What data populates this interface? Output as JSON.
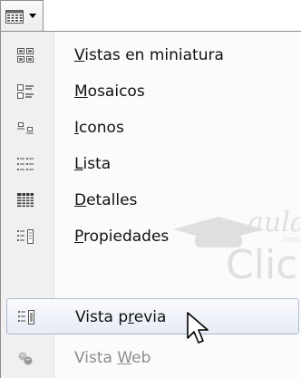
{
  "toolbar": {
    "button_icon": "view-details-icon",
    "dropdown_icon": "chevron-down-icon"
  },
  "menu": {
    "items": [
      {
        "pre": "",
        "key": "V",
        "post": "istas en miniatura",
        "icon": "thumbnails-view-icon",
        "enabled": true,
        "selected": false
      },
      {
        "pre": "",
        "key": "M",
        "post": "osaicos",
        "icon": "tiles-view-icon",
        "enabled": true,
        "selected": false
      },
      {
        "pre": "",
        "key": "I",
        "post": "conos",
        "icon": "icons-view-icon",
        "enabled": true,
        "selected": false
      },
      {
        "pre": "",
        "key": "L",
        "post": "ista",
        "icon": "list-view-icon",
        "enabled": true,
        "selected": false
      },
      {
        "pre": "",
        "key": "D",
        "post": "etalles",
        "icon": "details-view-icon",
        "enabled": true,
        "selected": false
      },
      {
        "pre": "",
        "key": "P",
        "post": "ropiedades",
        "icon": "properties-view-icon",
        "enabled": true,
        "selected": false
      },
      {
        "pre": "Vista p",
        "key": "r",
        "post": "evia",
        "icon": "preview-view-icon",
        "enabled": true,
        "selected": true
      },
      {
        "pre": "Vista ",
        "key": "W",
        "post": "eb",
        "icon": "web-view-icon",
        "enabled": false,
        "selected": false
      }
    ]
  },
  "watermark": {
    "text_top": "aula",
    "text_com": ".com",
    "text_main": "Clic",
    "icon": "graduation-cap-icon"
  },
  "cursor": {
    "icon": "mouse-pointer-icon"
  },
  "colors": {
    "selection_border": "#aeb9cf",
    "gutter": "#f0f0f0",
    "disabled_text": "#8d8d8d"
  }
}
